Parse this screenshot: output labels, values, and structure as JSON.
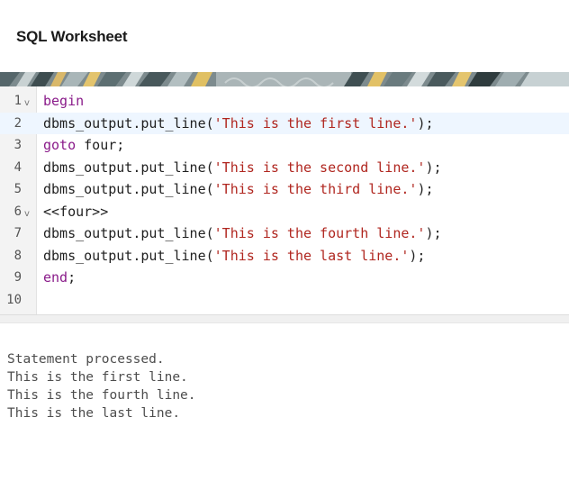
{
  "worksheet": {
    "title": "SQL Worksheet"
  },
  "editor": {
    "lines": [
      {
        "number": "1",
        "fold": "v",
        "tokens": [
          {
            "type": "kw",
            "text": "begin"
          }
        ]
      },
      {
        "number": "2",
        "fold": "",
        "active": true,
        "tokens": [
          {
            "type": "plain",
            "text": "dbms_output.put_line("
          },
          {
            "type": "str",
            "text": "'This is the first line.'"
          },
          {
            "type": "plain",
            "text": ");"
          }
        ]
      },
      {
        "number": "3",
        "fold": "",
        "tokens": [
          {
            "type": "kw",
            "text": "goto"
          },
          {
            "type": "plain",
            "text": " four;"
          }
        ]
      },
      {
        "number": "4",
        "fold": "",
        "tokens": [
          {
            "type": "plain",
            "text": "dbms_output.put_line("
          },
          {
            "type": "str",
            "text": "'This is the second line.'"
          },
          {
            "type": "plain",
            "text": ");"
          }
        ]
      },
      {
        "number": "5",
        "fold": "",
        "tokens": [
          {
            "type": "plain",
            "text": "dbms_output.put_line("
          },
          {
            "type": "str",
            "text": "'This is the third line.'"
          },
          {
            "type": "plain",
            "text": ");"
          }
        ]
      },
      {
        "number": "6",
        "fold": "v",
        "tokens": [
          {
            "type": "plain",
            "text": "<<four>>"
          }
        ]
      },
      {
        "number": "7",
        "fold": "",
        "tokens": [
          {
            "type": "plain",
            "text": "dbms_output.put_line("
          },
          {
            "type": "str",
            "text": "'This is the fourth line.'"
          },
          {
            "type": "plain",
            "text": ");"
          }
        ]
      },
      {
        "number": "8",
        "fold": "",
        "tokens": [
          {
            "type": "plain",
            "text": "dbms_output.put_line("
          },
          {
            "type": "str",
            "text": "'This is the last line.'"
          },
          {
            "type": "plain",
            "text": ");"
          }
        ]
      },
      {
        "number": "9",
        "fold": "",
        "tokens": [
          {
            "type": "kw",
            "text": "end"
          },
          {
            "type": "plain",
            "text": ";"
          }
        ]
      },
      {
        "number": "10",
        "fold": "",
        "tokens": []
      }
    ]
  },
  "output": {
    "lines": [
      "Statement processed.",
      "This is the first line.",
      "This is the fourth line.",
      "This is the last line."
    ]
  }
}
